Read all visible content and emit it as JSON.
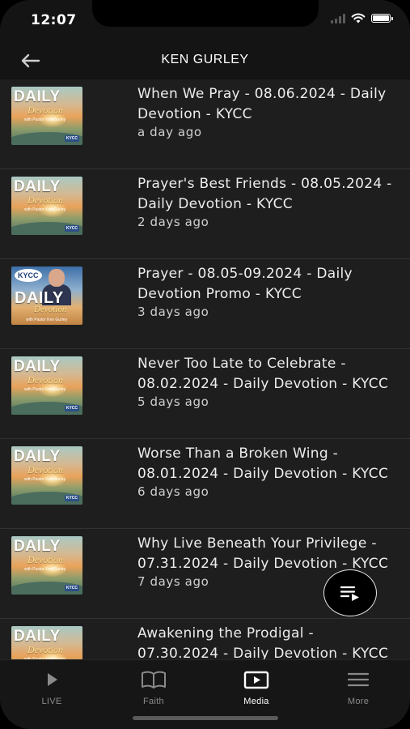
{
  "status_bar": {
    "time": "12:07",
    "icons": [
      "cellular-signal-icon",
      "wifi-icon",
      "battery-icon"
    ]
  },
  "header": {
    "back_icon": "arrow-left-icon",
    "title": "KEN GURLEY"
  },
  "thumbnail_text": {
    "daily": "DAILY",
    "devotion": "Devotion",
    "with": "with Pastor Ken Gurley",
    "kycc": "KYCC"
  },
  "episodes": [
    {
      "title": "When We Pray - 08.06.2024 - Daily Devotion - KYCC",
      "age": "a day ago",
      "thumb": "daily"
    },
    {
      "title": "Prayer's Best Friends - 08.05.2024 - Daily Devotion - KYCC",
      "age": "2 days ago",
      "thumb": "daily"
    },
    {
      "title": "Prayer - 08.05-09.2024 - Daily Devotion Promo - KYCC",
      "age": "3 days ago",
      "thumb": "promo"
    },
    {
      "title": "Never Too Late to Celebrate - 08.02.2024 - Daily Devotion - KYCC",
      "age": "5 days ago",
      "thumb": "daily"
    },
    {
      "title": "Worse Than a Broken Wing - 08.01.2024 - Daily Devotion - KYCC",
      "age": "6 days ago",
      "thumb": "daily"
    },
    {
      "title": "Why Live Beneath Your Privilege - 07.31.2024 - Daily Devotion - KYCC",
      "age": "7 days ago",
      "thumb": "daily"
    },
    {
      "title": "Awakening the Prodigal - 07.30.2024 - Daily Devotion - KYCC",
      "age": "",
      "thumb": "daily"
    }
  ],
  "fab": {
    "icon": "queue-playlist-icon"
  },
  "tabs": [
    {
      "label": "LIVE",
      "icon": "play-icon",
      "active": false
    },
    {
      "label": "Faith",
      "icon": "book-open-icon",
      "active": false
    },
    {
      "label": "Media",
      "icon": "video-play-icon",
      "active": true
    },
    {
      "label": "More",
      "icon": "menu-lines-icon",
      "active": false
    }
  ],
  "colors": {
    "background": "#1e1e1e",
    "header": "#141414",
    "separator": "#323232",
    "tab_active": "#ffffff",
    "tab_inactive": "#8a8a8a"
  }
}
